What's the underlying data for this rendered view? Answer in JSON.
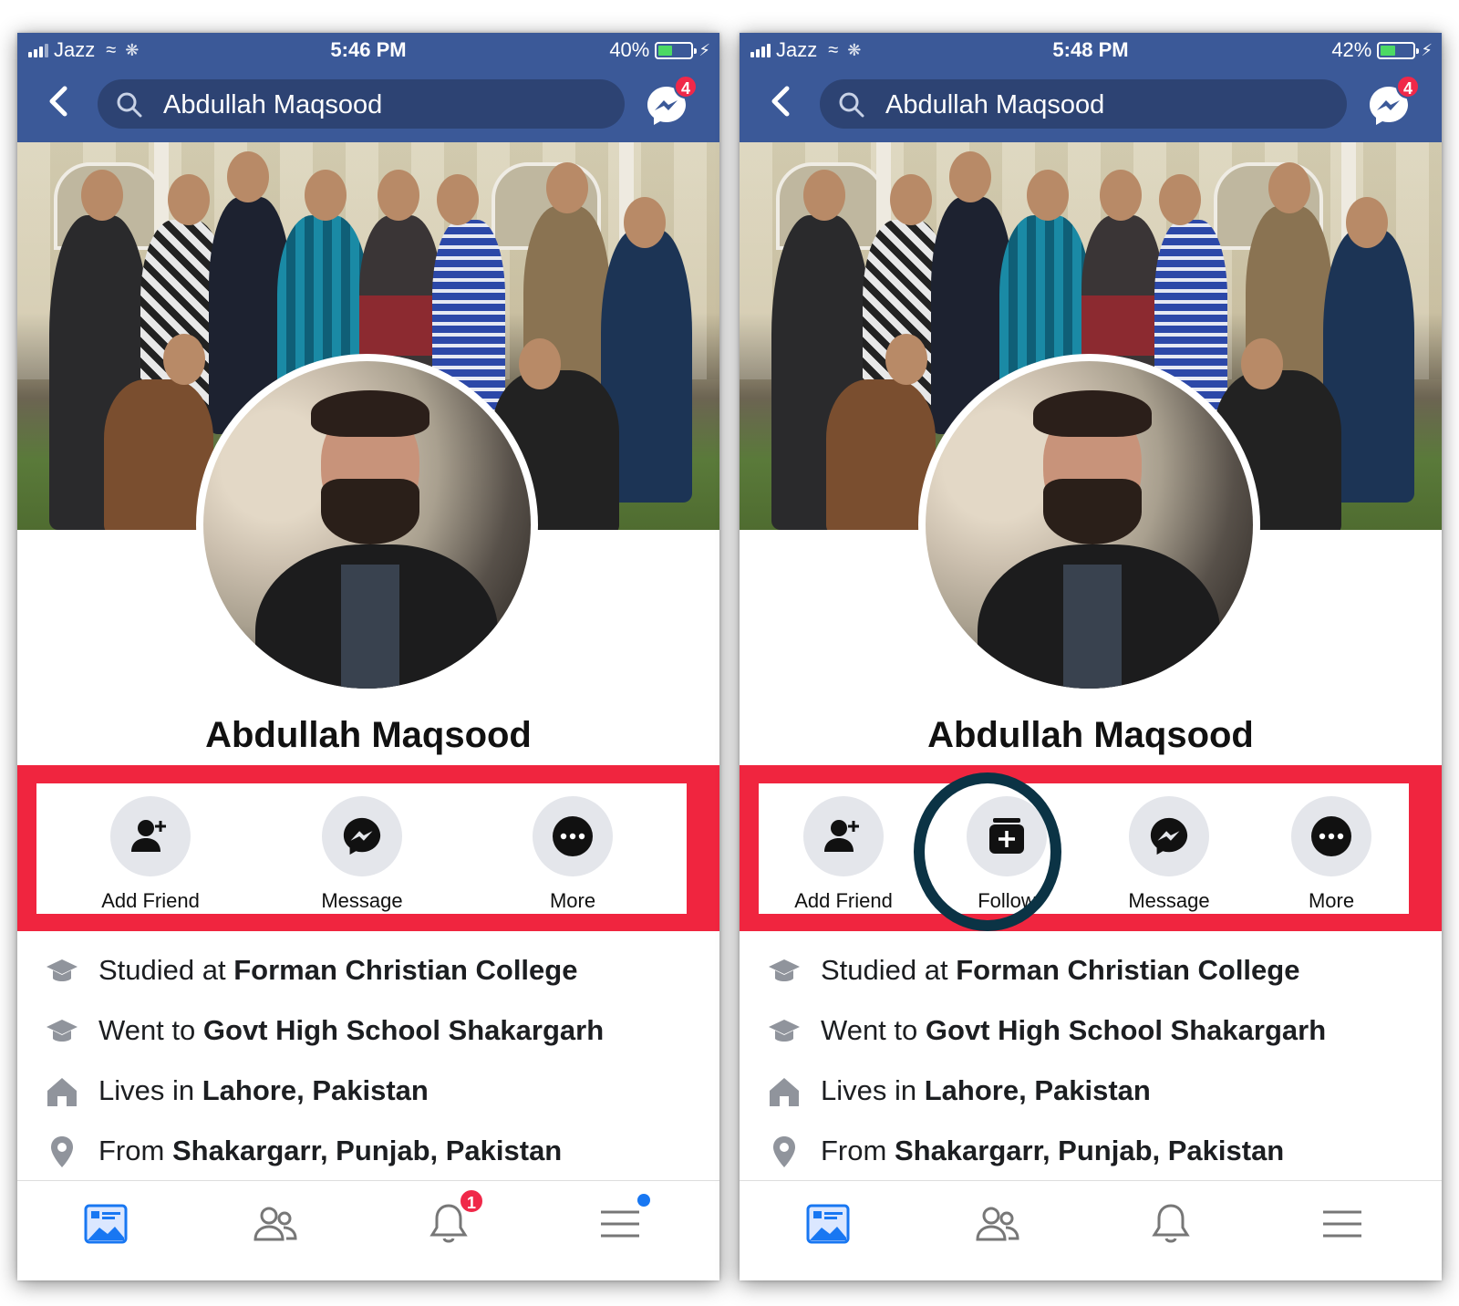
{
  "colors": {
    "header": "#3b5998",
    "highlight_band": "#f0253f",
    "follow_ring": "#0b3345",
    "badge": "#f02849"
  },
  "screens": [
    {
      "status": {
        "carrier": "Jazz",
        "time": "5:46 PM",
        "battery": "40%",
        "battery_level": 0.4
      },
      "search": {
        "query": "Abdullah Maqsood"
      },
      "messenger_badge": "4",
      "profile_name": "Abdullah Maqsood",
      "actions": [
        "Add Friend",
        "Message",
        "More"
      ],
      "info": [
        {
          "prefix": "Studied at",
          "value": "Forman Christian College"
        },
        {
          "prefix": "Went to",
          "value": "Govt High School Shakargarh"
        },
        {
          "prefix": "Lives in",
          "value": "Lahore, Pakistan"
        },
        {
          "prefix": "From",
          "value": "Shakargarr, Punjab, Pakistan"
        }
      ],
      "tabs": {
        "notifications_badge": "1"
      }
    },
    {
      "status": {
        "carrier": "Jazz",
        "time": "5:48 PM",
        "battery": "42%",
        "battery_level": 0.42
      },
      "search": {
        "query": "Abdullah Maqsood"
      },
      "messenger_badge": "4",
      "profile_name": "Abdullah Maqsood",
      "actions": [
        "Add Friend",
        "Follow",
        "Message",
        "More"
      ],
      "info": [
        {
          "prefix": "Studied at",
          "value": "Forman Christian College"
        },
        {
          "prefix": "Went to",
          "value": "Govt High School Shakargarh"
        },
        {
          "prefix": "Lives in",
          "value": "Lahore, Pakistan"
        },
        {
          "prefix": "From",
          "value": "Shakargarr, Punjab, Pakistan"
        }
      ],
      "tabs": {
        "notifications_badge": ""
      }
    }
  ]
}
